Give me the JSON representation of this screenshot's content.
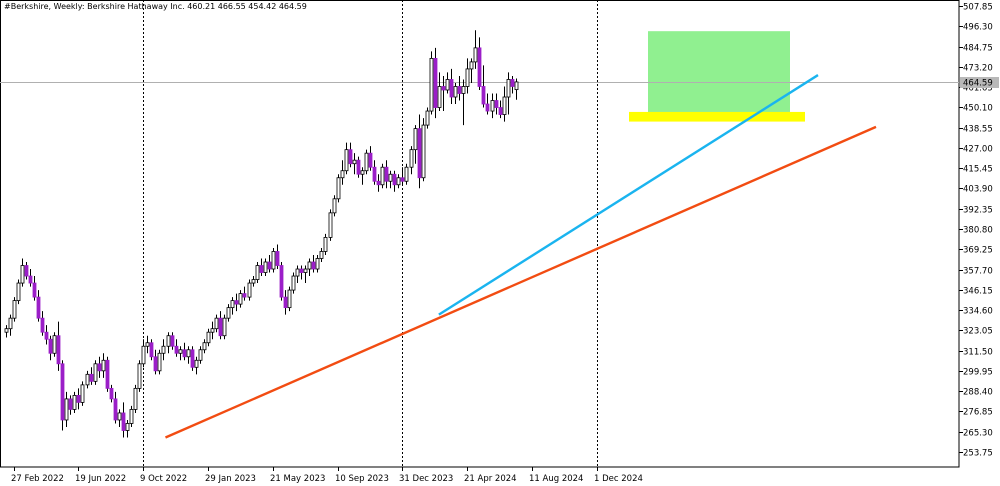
{
  "header": {
    "symbol": "#Berkshire",
    "timeframe": "Weekly:",
    "name": "Berkshire Hathaway Inc.",
    "ohlc": "460.21 466.55 454.42 464.59"
  },
  "colors": {
    "bull_candle": "#ffffff",
    "bear_candle": "#9b1fc8",
    "candle_outline": "#000000",
    "blue_trendline": "#1ab4ef",
    "orange_trendline": "#f24c12",
    "green_zone": "#90f090",
    "yellow_zone": "#ffff00",
    "price_line": "#b0b0b0",
    "grid_vertical": "#000000"
  },
  "chart_data": {
    "type": "candlestick",
    "title": "#Berkshire, Weekly: Berkshire Hathaway Inc. 460.21 466.55 454.42 464.59",
    "x_axis_labels": [
      "27 Feb 2022",
      "19 Jun 2022",
      "9 Oct 2022",
      "29 Jan 2023",
      "21 May 2023",
      "10 Sep 2023",
      "31 Dec 2023",
      "21 Apr 2024",
      "11 Aug 2024",
      "1 Dec 2024"
    ],
    "y_axis_labels": [
      "507.85",
      "496.30",
      "484.75",
      "473.20",
      "461.65",
      "450.10",
      "438.55",
      "427.00",
      "415.45",
      "403.90",
      "392.35",
      "380.80",
      "369.25",
      "357.70",
      "346.15",
      "334.60",
      "323.05",
      "311.50",
      "299.95",
      "288.40",
      "276.85",
      "265.30",
      "253.75"
    ],
    "ylim": [
      249.0,
      510.0
    ],
    "current_price_label": "464.59",
    "current_price": 464.59,
    "vertical_separators": [
      "9 Oct 2022",
      "31 Dec 2023",
      "1 Dec 2024"
    ],
    "candles": [
      [
        322,
        326,
        319,
        324
      ],
      [
        324,
        332,
        320,
        330
      ],
      [
        330,
        342,
        328,
        340
      ],
      [
        340,
        352,
        338,
        350
      ],
      [
        350,
        364,
        348,
        360
      ],
      [
        360,
        362,
        352,
        354
      ],
      [
        354,
        358,
        348,
        350
      ],
      [
        350,
        354,
        340,
        342
      ],
      [
        342,
        346,
        328,
        330
      ],
      [
        330,
        334,
        320,
        322
      ],
      [
        322,
        326,
        315,
        318
      ],
      [
        318,
        320,
        306,
        310
      ],
      [
        310,
        322,
        308,
        320
      ],
      [
        320,
        328,
        300,
        304
      ],
      [
        304,
        306,
        266,
        272
      ],
      [
        272,
        288,
        268,
        284
      ],
      [
        284,
        286,
        275,
        278
      ],
      [
        278,
        288,
        276,
        286
      ],
      [
        286,
        290,
        278,
        282
      ],
      [
        282,
        294,
        280,
        292
      ],
      [
        292,
        300,
        290,
        298
      ],
      [
        298,
        302,
        292,
        294
      ],
      [
        294,
        306,
        292,
        304
      ],
      [
        304,
        308,
        296,
        300
      ],
      [
        300,
        310,
        296,
        306
      ],
      [
        306,
        308,
        288,
        290
      ],
      [
        290,
        292,
        282,
        284
      ],
      [
        284,
        288,
        270,
        272
      ],
      [
        272,
        278,
        268,
        276
      ],
      [
        276,
        282,
        262,
        266
      ],
      [
        266,
        272,
        262,
        270
      ],
      [
        270,
        280,
        268,
        278
      ],
      [
        278,
        292,
        276,
        290
      ],
      [
        290,
        306,
        288,
        304
      ],
      [
        304,
        318,
        302,
        314
      ],
      [
        314,
        320,
        310,
        316
      ],
      [
        316,
        318,
        306,
        308
      ],
      [
        308,
        312,
        298,
        300
      ],
      [
        300,
        312,
        298,
        310
      ],
      [
        310,
        318,
        306,
        314
      ],
      [
        314,
        322,
        310,
        320
      ],
      [
        320,
        322,
        312,
        314
      ],
      [
        314,
        318,
        308,
        310
      ],
      [
        310,
        314,
        306,
        312
      ],
      [
        312,
        316,
        306,
        308
      ],
      [
        308,
        314,
        304,
        312
      ],
      [
        312,
        314,
        300,
        302
      ],
      [
        302,
        308,
        298,
        306
      ],
      [
        306,
        314,
        304,
        312
      ],
      [
        312,
        318,
        310,
        316
      ],
      [
        316,
        324,
        314,
        322
      ],
      [
        322,
        328,
        318,
        324
      ],
      [
        324,
        332,
        322,
        330
      ],
      [
        330,
        334,
        318,
        320
      ],
      [
        320,
        332,
        318,
        330
      ],
      [
        330,
        338,
        328,
        336
      ],
      [
        336,
        342,
        332,
        340
      ],
      [
        340,
        344,
        334,
        338
      ],
      [
        338,
        346,
        336,
        344
      ],
      [
        344,
        348,
        340,
        342
      ],
      [
        342,
        352,
        340,
        350
      ],
      [
        350,
        354,
        348,
        352
      ],
      [
        352,
        362,
        350,
        360
      ],
      [
        360,
        364,
        354,
        356
      ],
      [
        356,
        364,
        354,
        362
      ],
      [
        362,
        366,
        356,
        358
      ],
      [
        358,
        370,
        356,
        368
      ],
      [
        368,
        372,
        358,
        360
      ],
      [
        360,
        362,
        340,
        342
      ],
      [
        342,
        346,
        332,
        336
      ],
      [
        336,
        348,
        334,
        346
      ],
      [
        346,
        356,
        344,
        354
      ],
      [
        354,
        360,
        350,
        358
      ],
      [
        358,
        360,
        352,
        356
      ],
      [
        356,
        360,
        350,
        358
      ],
      [
        358,
        364,
        354,
        362
      ],
      [
        362,
        366,
        356,
        358
      ],
      [
        358,
        366,
        356,
        364
      ],
      [
        364,
        370,
        362,
        368
      ],
      [
        368,
        378,
        366,
        376
      ],
      [
        376,
        392,
        374,
        390
      ],
      [
        390,
        400,
        388,
        398
      ],
      [
        398,
        412,
        396,
        410
      ],
      [
        410,
        420,
        406,
        414
      ],
      [
        414,
        430,
        412,
        426
      ],
      [
        426,
        430,
        416,
        418
      ],
      [
        418,
        424,
        412,
        420
      ],
      [
        420,
        422,
        410,
        412
      ],
      [
        412,
        416,
        406,
        414
      ],
      [
        414,
        426,
        412,
        424
      ],
      [
        424,
        428,
        414,
        416
      ],
      [
        416,
        420,
        406,
        408
      ],
      [
        408,
        412,
        402,
        406
      ],
      [
        406,
        418,
        404,
        416
      ],
      [
        416,
        420,
        404,
        408
      ],
      [
        408,
        414,
        404,
        412
      ],
      [
        412,
        414,
        402,
        406
      ],
      [
        406,
        412,
        404,
        410
      ],
      [
        410,
        416,
        406,
        408
      ],
      [
        408,
        418,
        406,
        416
      ],
      [
        416,
        428,
        412,
        426
      ],
      [
        426,
        440,
        418,
        438
      ],
      [
        438,
        446,
        404,
        410
      ],
      [
        410,
        444,
        408,
        440
      ],
      [
        440,
        450,
        438,
        448
      ],
      [
        448,
        482,
        446,
        478
      ],
      [
        478,
        484,
        444,
        450
      ],
      [
        450,
        470,
        448,
        462
      ],
      [
        462,
        468,
        448,
        460
      ],
      [
        460,
        470,
        458,
        466
      ],
      [
        466,
        472,
        452,
        456
      ],
      [
        456,
        464,
        452,
        462
      ],
      [
        462,
        468,
        454,
        458
      ],
      [
        458,
        466,
        440,
        462
      ],
      [
        462,
        478,
        458,
        472
      ],
      [
        472,
        478,
        464,
        476
      ],
      [
        476,
        494,
        472,
        484
      ],
      [
        484,
        490,
        460,
        462
      ],
      [
        462,
        474,
        450,
        452
      ],
      [
        452,
        458,
        446,
        448
      ],
      [
        448,
        458,
        444,
        454
      ],
      [
        454,
        458,
        446,
        450
      ],
      [
        450,
        454,
        444,
        446
      ],
      [
        446,
        462,
        442,
        456
      ],
      [
        456,
        470,
        446,
        466
      ],
      [
        466,
        468,
        458,
        462
      ],
      [
        460.21,
        466.55,
        454.42,
        464.59
      ]
    ],
    "start_x": 5.5,
    "step_px": 4.05
  }
}
